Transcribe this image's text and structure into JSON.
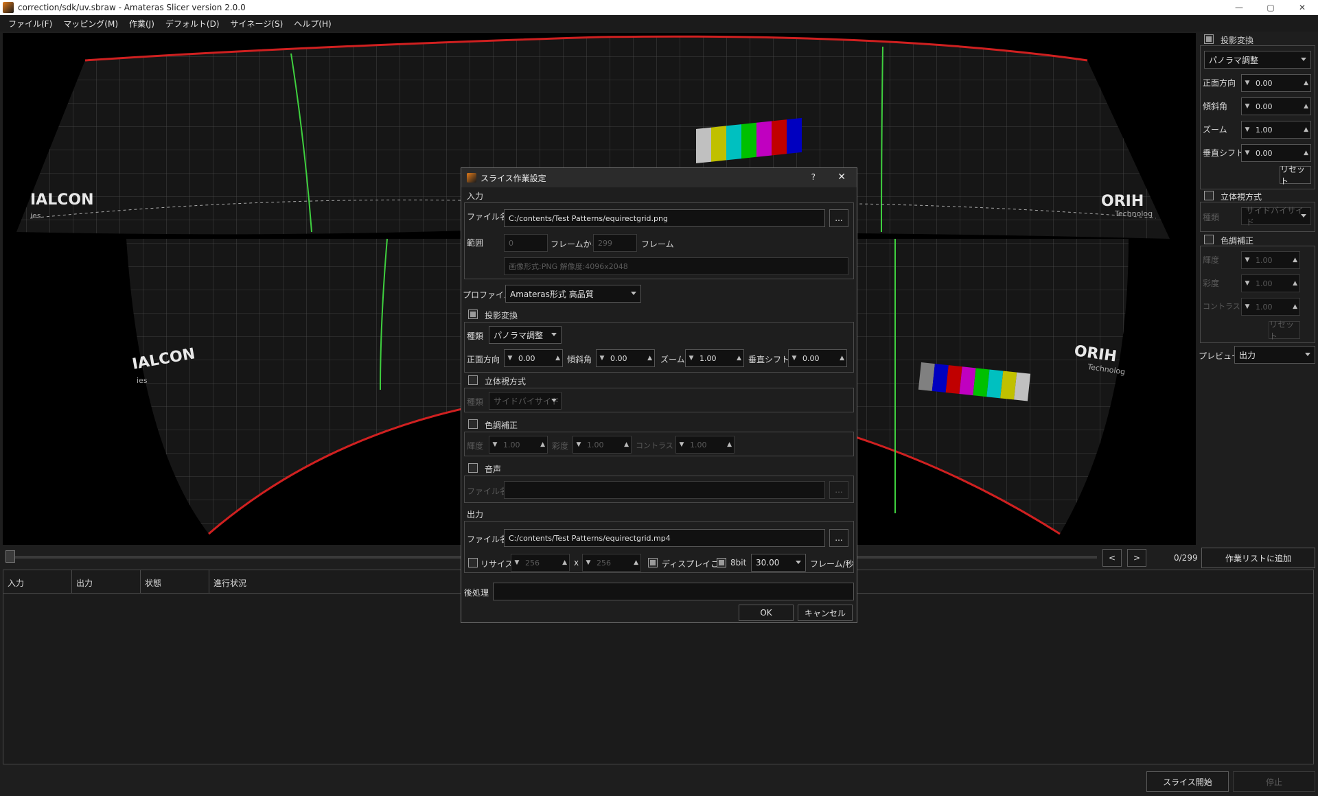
{
  "window": {
    "title": "correction/sdk/uv.sbraw - Amateras Slicer version 2.0.0",
    "minimize": "—",
    "maximize": "▢",
    "close": "✕"
  },
  "menu": [
    "ファイル(F)",
    "マッピング(M)",
    "作業(J)",
    "デフォルト(D)",
    "サイネージ(S)",
    "ヘルプ(H)"
  ],
  "viewport": {
    "logo_left_top": "IALCON",
    "logo_left_sub_top": "ies",
    "logo_left_bottom": "IALCON",
    "logo_left_sub_bottom": "ies",
    "logo_right_top": "ORIH",
    "logo_right_sub_top": "Technolog",
    "logo_right_bottom": "ORIH",
    "logo_right_sub_bottom": "Technolog"
  },
  "right_panel": {
    "projection_label": "投影変換",
    "projection_checked": true,
    "projection_type": "パノラマ調整",
    "front_label": "正面方向",
    "front_value": "0.00",
    "tilt_label": "傾斜角",
    "tilt_value": "0.00",
    "zoom_label": "ズーム",
    "zoom_value": "1.00",
    "vshift_label": "垂直シフト",
    "vshift_value": "0.00",
    "reset_label": "リセット",
    "stereo_label": "立体視方式",
    "stereo_checked": false,
    "stereo_type_label": "種類",
    "stereo_type_value": "サイドバイサイド",
    "color_label": "色調補正",
    "color_checked": false,
    "brightness_label": "輝度",
    "brightness_value": "1.00",
    "saturation_label": "彩度",
    "saturation_value": "1.00",
    "contrast_label": "コントラスト",
    "contrast_value": "1.00",
    "color_reset_label": "リセット",
    "preview_label": "プレビュー",
    "preview_value": "出力"
  },
  "seek": {
    "frame_counter": "0/299",
    "prev": "<",
    "next": ">",
    "add_job_label": "作業リストに追加"
  },
  "job_table": {
    "columns": [
      "入力",
      "出力",
      "状態",
      "進行状況"
    ]
  },
  "bottom": {
    "start_label": "スライス開始",
    "stop_label": "停止"
  },
  "dialog": {
    "title": "スライス作業設定",
    "help": "?",
    "close": "✕",
    "input_section": "入力",
    "file_label": "ファイル名",
    "file_value": "C:/contents/Test Patterns/equirectgrid.png",
    "browse": "...",
    "range_label": "範囲",
    "range_from": "0",
    "from_label": "フレームから",
    "range_to": "299",
    "frame_label": "フレーム",
    "info": "画像形式:PNG 解像度:4096x2048",
    "profile_label": "プロファイル",
    "profile_value": "Amateras形式 高品質",
    "projection_label": "投影変換",
    "projection_checked": true,
    "type_label": "種類",
    "type_value": "パノラマ調整",
    "front_label": "正面方向",
    "front_value": "0.00",
    "tilt_label": "傾斜角",
    "tilt_value": "0.00",
    "zoom_label": "ズーム",
    "zoom_value": "1.00",
    "vshift_label": "垂直シフト",
    "vshift_value": "0.00",
    "stereo_label": "立体視方式",
    "stereo_checked": false,
    "stereo_type_label": "種類",
    "stereo_type_value": "サイドバイサイド",
    "color_label": "色調補正",
    "color_checked": false,
    "brightness_label": "輝度",
    "brightness_value": "1.00",
    "saturation_label": "彩度",
    "saturation_value": "1.00",
    "contrast_label": "コントラスト",
    "contrast_value": "1.00",
    "audio_label": "音声",
    "audio_checked": false,
    "audio_file_label": "ファイル名",
    "audio_file_value": "",
    "audio_browse": "...",
    "output_section": "出力",
    "out_file_label": "ファイル名",
    "out_file_value": "C:/contents/Test Patterns/equirectgrid.mp4",
    "out_browse": "...",
    "resize_label": "リサイズ",
    "resize_checked": false,
    "resize_w": "256",
    "resize_x": "x",
    "resize_h": "256",
    "per_display_label": "ディスプレイごと",
    "per_display_checked": true,
    "bit8_label": "8bit",
    "bit8_checked": true,
    "fps_value": "30.00",
    "fps_label": "フレーム/秒",
    "post_label": "後処理",
    "post_value": "",
    "ok_label": "OK",
    "cancel_label": "キャンセル"
  }
}
